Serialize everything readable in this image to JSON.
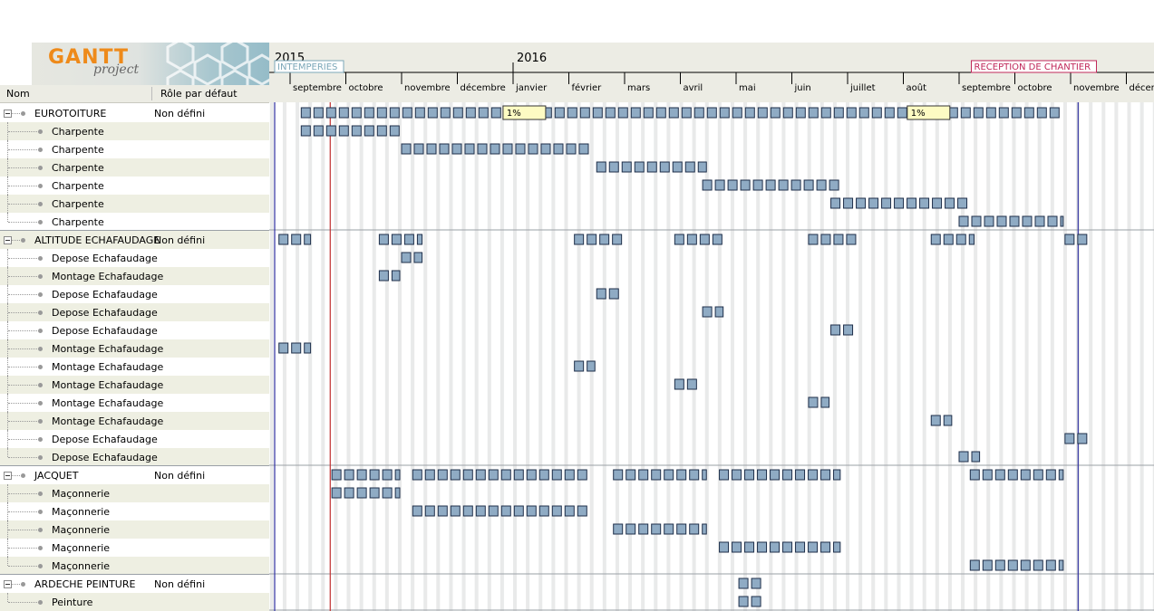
{
  "logo": {
    "gantt": "GANTT",
    "project": "project"
  },
  "table": {
    "col_name": "Nom",
    "col_role": "Rôle par défaut"
  },
  "rows": [
    {
      "name": "EUROTOITURE",
      "role": "Non défini",
      "level": 0
    },
    {
      "name": "Charpente",
      "role": "",
      "level": 1
    },
    {
      "name": "Charpente",
      "role": "",
      "level": 1
    },
    {
      "name": "Charpente",
      "role": "",
      "level": 1
    },
    {
      "name": "Charpente",
      "role": "",
      "level": 1
    },
    {
      "name": "Charpente",
      "role": "",
      "level": 1
    },
    {
      "name": "Charpente",
      "role": "",
      "level": 1
    },
    {
      "name": "ALTITUDE ECHAFAUDAGE",
      "role": "Non défini",
      "level": 0
    },
    {
      "name": "Depose Echafaudage",
      "role": "",
      "level": 1
    },
    {
      "name": "Montage Echafaudage",
      "role": "",
      "level": 1
    },
    {
      "name": "Depose Echafaudage",
      "role": "",
      "level": 1
    },
    {
      "name": "Depose Echafaudage",
      "role": "",
      "level": 1
    },
    {
      "name": "Depose Echafaudage",
      "role": "",
      "level": 1
    },
    {
      "name": "Montage Echafaudage",
      "role": "",
      "level": 1
    },
    {
      "name": "Montage Echafaudage",
      "role": "",
      "level": 1
    },
    {
      "name": "Montage Echafaudage",
      "role": "",
      "level": 1
    },
    {
      "name": "Montage Echafaudage",
      "role": "",
      "level": 1
    },
    {
      "name": "Montage Echafaudage",
      "role": "",
      "level": 1
    },
    {
      "name": "Depose Echafaudage",
      "role": "",
      "level": 1
    },
    {
      "name": "Depose Echafaudage",
      "role": "",
      "level": 1
    },
    {
      "name": "JACQUET",
      "role": "Non défini",
      "level": 0
    },
    {
      "name": "Maçonnerie",
      "role": "",
      "level": 1
    },
    {
      "name": "Maçonnerie",
      "role": "",
      "level": 1
    },
    {
      "name": "Maçonnerie",
      "role": "",
      "level": 1
    },
    {
      "name": "Maçonnerie",
      "role": "",
      "level": 1
    },
    {
      "name": "Maçonnerie",
      "role": "",
      "level": 1
    },
    {
      "name": "ARDECHE PEINTURE",
      "role": "Non défini",
      "level": 0
    },
    {
      "name": "Peinture",
      "role": "",
      "level": 1
    }
  ],
  "timeline": {
    "years": [
      {
        "label": "2015",
        "month": 0
      },
      {
        "label": "2016",
        "month": 4
      }
    ],
    "months": [
      "septembre",
      "octobre",
      "novembre",
      "décembre",
      "janvier",
      "février",
      "mars",
      "avril",
      "mai",
      "juin",
      "juillet",
      "août",
      "septembre",
      "octobre",
      "novembre",
      "décemb"
    ],
    "milestones": [
      {
        "label": "INTEMPERIES",
        "month": -0.3,
        "color": "#7ba7b8"
      },
      {
        "label": "RECEPTION DE CHANTIER",
        "month": 13.0,
        "color": "#c0285a"
      }
    ],
    "today_month": 0.72,
    "project_start_month": -0.3,
    "project_end_month": 14.2
  },
  "summary_labels": [
    {
      "row": 0,
      "month": 3.95,
      "label": "1%"
    },
    {
      "row": 0,
      "month": 11.2,
      "label": "1%"
    }
  ],
  "bars": [
    {
      "row": 0,
      "start": 0.2,
      "end": 13.9
    },
    {
      "row": 1,
      "start": 0.2,
      "end": 2.0
    },
    {
      "row": 2,
      "start": 2.0,
      "end": 5.4
    },
    {
      "row": 3,
      "start": 5.5,
      "end": 7.5
    },
    {
      "row": 4,
      "start": 7.4,
      "end": 9.9
    },
    {
      "row": 5,
      "start": 9.7,
      "end": 12.2
    },
    {
      "row": 6,
      "start": 12.0,
      "end": 13.9
    },
    {
      "row": 7,
      "start": -0.2,
      "end": 0.4
    },
    {
      "row": 7,
      "start": 1.6,
      "end": 2.4
    },
    {
      "row": 7,
      "start": 5.1,
      "end": 6.0
    },
    {
      "row": 7,
      "start": 6.9,
      "end": 7.8
    },
    {
      "row": 7,
      "start": 9.3,
      "end": 10.2
    },
    {
      "row": 7,
      "start": 11.5,
      "end": 12.3
    },
    {
      "row": 7,
      "start": 13.9,
      "end": 14.4
    },
    {
      "row": 8,
      "start": 2.0,
      "end": 2.4
    },
    {
      "row": 9,
      "start": 1.6,
      "end": 2.0
    },
    {
      "row": 10,
      "start": 5.5,
      "end": 6.0
    },
    {
      "row": 11,
      "start": 7.4,
      "end": 7.8
    },
    {
      "row": 12,
      "start": 9.7,
      "end": 10.2
    },
    {
      "row": 13,
      "start": -0.2,
      "end": 0.4
    },
    {
      "row": 14,
      "start": 5.1,
      "end": 5.5
    },
    {
      "row": 15,
      "start": 6.9,
      "end": 7.4
    },
    {
      "row": 16,
      "start": 9.3,
      "end": 9.7
    },
    {
      "row": 17,
      "start": 11.5,
      "end": 11.9
    },
    {
      "row": 18,
      "start": 13.9,
      "end": 14.4
    },
    {
      "row": 19,
      "start": 12.0,
      "end": 12.4
    },
    {
      "row": 20,
      "start": 0.75,
      "end": 2.0
    },
    {
      "row": 20,
      "start": 2.2,
      "end": 5.4
    },
    {
      "row": 20,
      "start": 5.8,
      "end": 7.5
    },
    {
      "row": 20,
      "start": 7.7,
      "end": 9.9
    },
    {
      "row": 20,
      "start": 12.2,
      "end": 13.9
    },
    {
      "row": 21,
      "start": 0.75,
      "end": 2.0
    },
    {
      "row": 22,
      "start": 2.2,
      "end": 5.4
    },
    {
      "row": 23,
      "start": 5.8,
      "end": 7.5
    },
    {
      "row": 24,
      "start": 7.7,
      "end": 9.9
    },
    {
      "row": 25,
      "start": 12.2,
      "end": 13.9
    },
    {
      "row": 26,
      "start": 8.05,
      "end": 8.55
    },
    {
      "row": 27,
      "start": 8.05,
      "end": 8.55
    }
  ],
  "colors": {
    "bar_fill": "#8fabc4",
    "bar_stroke": "#1f2f4a",
    "summary_label_fill": "#fdfbc3",
    "today_line": "#c03030",
    "project_line": "#3030a0",
    "group_line": "#9aa0a6",
    "weekend_stripe": "#e9eaea",
    "header_bg": "#ecece4"
  }
}
